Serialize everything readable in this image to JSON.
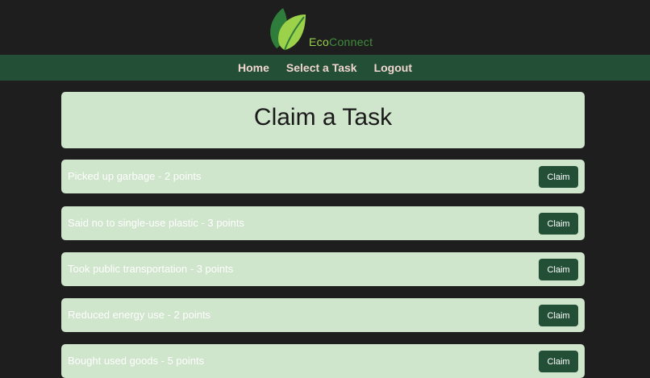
{
  "brand": {
    "name_part1": "Eco",
    "name_part2": "Connect"
  },
  "nav": {
    "items": [
      {
        "label": "Home"
      },
      {
        "label": "Select a Task"
      },
      {
        "label": "Logout"
      }
    ]
  },
  "main": {
    "title": "Claim a Task",
    "tasks": [
      {
        "text": "Picked up garbage - 2 points",
        "button": "Claim"
      },
      {
        "text": "Said no to single-use plastic - 3 points",
        "button": "Claim"
      },
      {
        "text": "Took public transportation - 3 points",
        "button": "Claim"
      },
      {
        "text": "Reduced energy use - 2 points",
        "button": "Claim"
      },
      {
        "text": "Bought used goods - 5 points",
        "button": "Claim"
      }
    ]
  },
  "colors": {
    "background": "#1e1e1e",
    "nav_bar": "#234f37",
    "nav_text": "#f1d6cf",
    "card": "#cfe5cc",
    "button": "#234f37",
    "logo_light_green": "#9bd24a",
    "logo_dark_green": "#3f8f3c"
  },
  "icons": {
    "logo": "leaf-icon"
  }
}
